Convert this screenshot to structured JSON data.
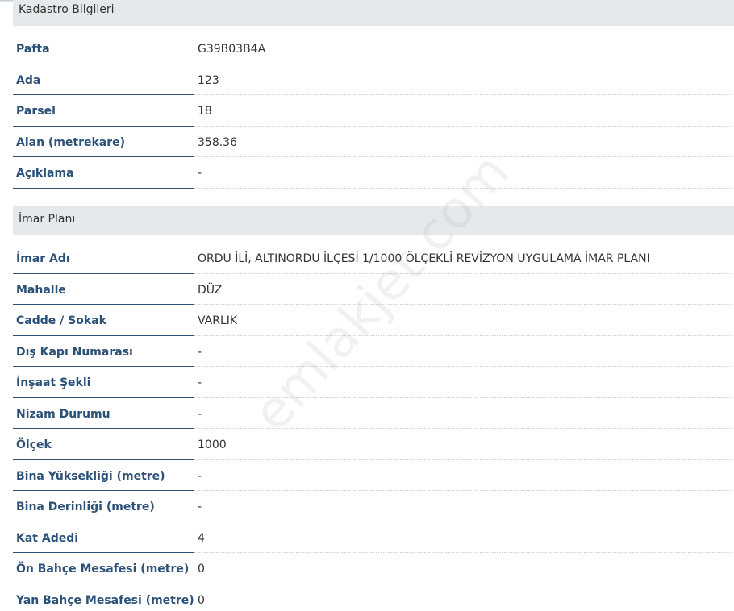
{
  "kadastro": {
    "title": "Kadastro Bilgileri",
    "rows": [
      {
        "label": "Pafta",
        "value": "G39B03B4A"
      },
      {
        "label": "Ada",
        "value": "123"
      },
      {
        "label": "Parsel",
        "value": "18"
      },
      {
        "label": "Alan (metrekare)",
        "value": "358.36"
      },
      {
        "label": "Açıklama",
        "value": "-"
      }
    ]
  },
  "imar": {
    "title": "İmar Planı",
    "rows": [
      {
        "label": "İmar Adı",
        "value": "ORDU İLİ, ALTINORDU İLÇESİ 1/1000 ÖLÇEKLİ REVİZYON UYGULAMA İMAR PLANI"
      },
      {
        "label": "Mahalle",
        "value": "DÜZ"
      },
      {
        "label": "Cadde / Sokak",
        "value": "VARLIK"
      },
      {
        "label": "Dış Kapı Numarası",
        "value": "-"
      },
      {
        "label": "İnşaat Şekli",
        "value": "-"
      },
      {
        "label": "Nizam Durumu",
        "value": "-"
      },
      {
        "label": "Ölçek",
        "value": "1000"
      },
      {
        "label": "Bina Yüksekliği (metre)",
        "value": "-"
      },
      {
        "label": "Bina Derinliği (metre)",
        "value": "-"
      },
      {
        "label": "Kat Adedi",
        "value": "4"
      },
      {
        "label": "Ön Bahçe Mesafesi (metre)",
        "value": "0"
      },
      {
        "label": "Yan Bahçe Mesafesi (metre)",
        "value": "0"
      }
    ]
  },
  "watermark": "emlakjet.com",
  "colors": {
    "label": "#2b5179",
    "value": "#333333",
    "header_bg": "#e6e9ec"
  }
}
